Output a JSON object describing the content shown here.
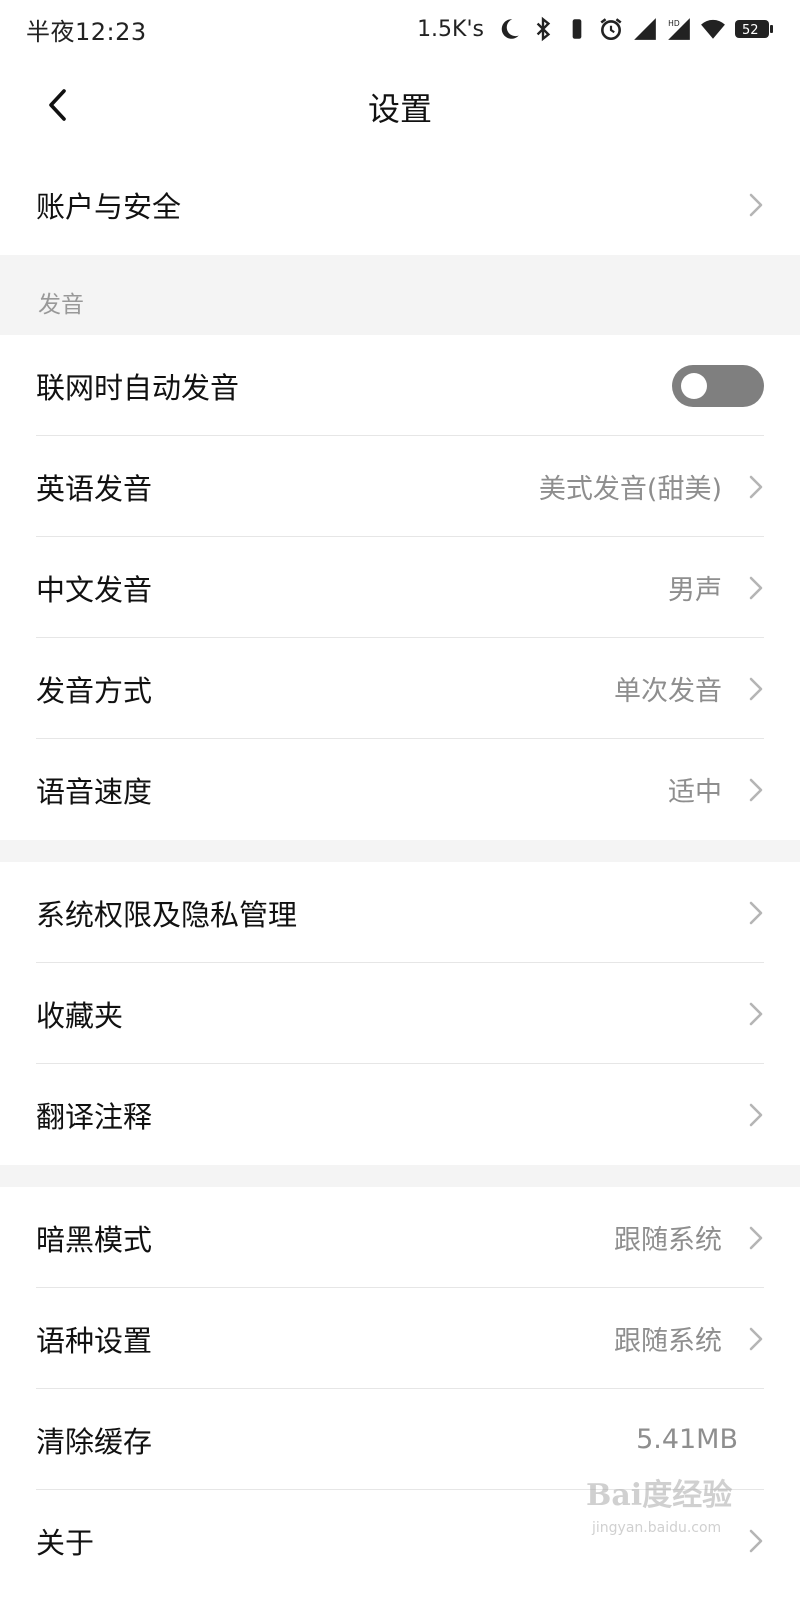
{
  "status_bar": {
    "time": "半夜12:23",
    "network_speed": "1.5K's",
    "icons": [
      "moon-icon",
      "bluetooth-icon",
      "battery-saver-icon",
      "alarm-icon",
      "signal-icon",
      "hd-signal-icon",
      "wifi-icon",
      "battery-icon"
    ],
    "battery_level": "52"
  },
  "header": {
    "back_icon": "chevron-left-icon",
    "title": "设置"
  },
  "account": {
    "label": "账户与安全"
  },
  "pronunciation_section": {
    "title": "发音",
    "auto_pronounce": {
      "label": "联网时自动发音",
      "enabled": false
    },
    "english": {
      "label": "英语发音",
      "value": "美式发音(甜美)"
    },
    "chinese": {
      "label": "中文发音",
      "value": "男声"
    },
    "mode": {
      "label": "发音方式",
      "value": "单次发音"
    },
    "speed": {
      "label": "语音速度",
      "value": "适中"
    }
  },
  "group2": {
    "permissions": {
      "label": "系统权限及隐私管理"
    },
    "favorites": {
      "label": "收藏夹"
    },
    "translation_notes": {
      "label": "翻译注释"
    }
  },
  "group3": {
    "dark_mode": {
      "label": "暗黑模式",
      "value": "跟随系统"
    },
    "language": {
      "label": "语种设置",
      "value": "跟随系统"
    },
    "clear_cache": {
      "label": "清除缓存",
      "value": "5.41MB"
    },
    "about": {
      "label": "关于"
    }
  },
  "watermark": {
    "logo": "Bai度经验",
    "url": "jingyan.baidu.com"
  },
  "colors": {
    "background": "#ffffff",
    "section_gap": "#f4f4f4",
    "label_text": "#111111",
    "value_text": "#8e8e8e",
    "toggle_off": "#7f7f7f",
    "chevron": "#b5b5b5"
  }
}
